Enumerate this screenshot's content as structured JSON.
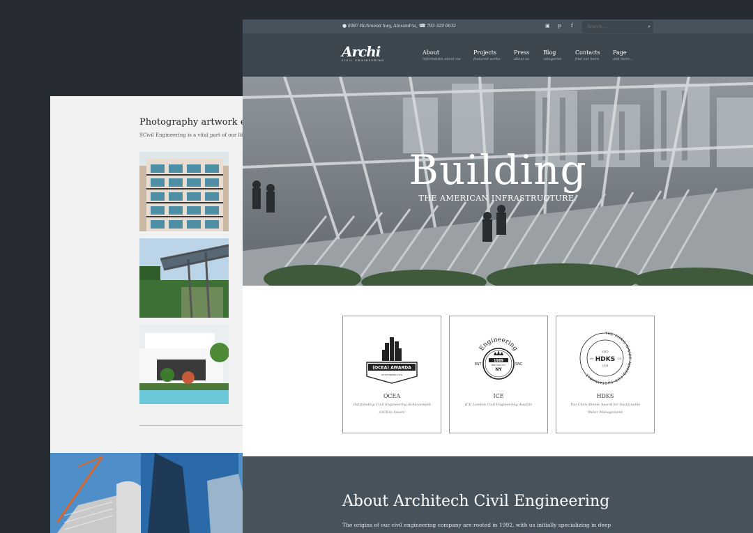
{
  "back_page": {
    "title": "Photography artwork exa",
    "subtitle": "SCivil Engineering is a vital part of our life, e"
  },
  "topbar": {
    "address": "6087 Richmond hwy, Alexandria, VA",
    "phone": "703 329 0632",
    "social_icons": [
      "instagram-icon",
      "pinterest-icon",
      "facebook-icon"
    ],
    "search_placeholder": "Search ..."
  },
  "logo": {
    "name": "Archi",
    "tagline": "CIVIL ENGINEERING"
  },
  "menu": [
    {
      "title": "About",
      "subtitle": "information about me"
    },
    {
      "title": "Projects",
      "subtitle": "featured works"
    },
    {
      "title": "Press",
      "subtitle": "about us"
    },
    {
      "title": "Blog",
      "subtitle": "categories"
    },
    {
      "title": "Contacts",
      "subtitle": "find out more"
    },
    {
      "title": "Page",
      "subtitle": "and more..."
    }
  ],
  "hero": {
    "title": "Building",
    "subtitle": "THE AMERICAN INFRASTRUCTURE."
  },
  "awards": [
    {
      "name": "OCEA",
      "description": "Outstanding Civil Engineering Achievement (OCEA) Award",
      "emblem_text": "(OCEA) AWARDA",
      "emblem_subtext": "OUTSTANDING CIVIL"
    },
    {
      "name": "ICE",
      "description": "ICE London Civil Engineering Awards",
      "emblem_text": "Engineering",
      "emblem_year": "1989",
      "emblem_city": "NEW YORK CITY",
      "emblem_abbr": "NY",
      "emblem_left": "EST",
      "emblem_right": "SNC"
    },
    {
      "name": "HDKS",
      "description": "The Chris Binnie Award for Sustainable Water Management",
      "emblem_text": "HDKS",
      "emblem_est": "ESTD",
      "emblem_year": "2014",
      "emblem_left": "VH",
      "emblem_right": "CO",
      "emblem_ring": "THE CHRIS BINNIE AWARD FOR SUSTAINABLE"
    }
  ],
  "about": {
    "heading": "About Architech Civil Engineering",
    "text": "The origins of our civil engineering company are rooted in 1992, with us initially specializing in deep"
  }
}
